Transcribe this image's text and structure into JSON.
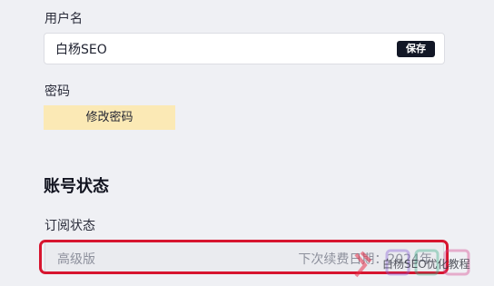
{
  "username": {
    "label": "用户名",
    "value": "白杨SEO",
    "save_label": "保存"
  },
  "password": {
    "label": "密码",
    "change_label": "修改密码"
  },
  "account_status": {
    "title": "账号状态",
    "subscription_label": "订阅状态",
    "plan": "高级版",
    "renewal": "下次续费日期：2024年"
  },
  "watermark": {
    "text": "白杨SEO优化教程"
  },
  "colors": {
    "background": "#eff0f4",
    "save_button": "#121726",
    "change_password_button": "#fbe9b5",
    "highlight": "#d7152f"
  }
}
